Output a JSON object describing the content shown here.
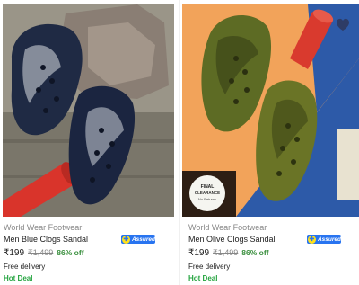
{
  "products": [
    {
      "brand": "World Wear Footwear",
      "title": "Men Blue Clogs Sandal",
      "assured_label": "Assured",
      "price": "₹199",
      "mrp": "₹1,499",
      "discount": "86% off",
      "delivery": "Free delivery",
      "deal": "Hot Deal",
      "image_icon": "blue-clogs-photo"
    },
    {
      "brand": "World Wear Footwear",
      "title": "Men Olive Clogs Sandal",
      "assured_label": "Assured",
      "price": "₹199",
      "mrp": "₹1,499",
      "discount": "86% off",
      "delivery": "Free delivery",
      "deal": "Hot Deal",
      "image_icon": "olive-clogs-photo",
      "image_tag": {
        "line1": "FINAL",
        "line2": "CLEARANCE",
        "line3": "No Returns"
      }
    }
  ],
  "colors": {
    "price_discount": "#388e3c",
    "hot_deal": "#26a541",
    "assured_badge": "#2874f0",
    "muted_text": "#878787"
  }
}
